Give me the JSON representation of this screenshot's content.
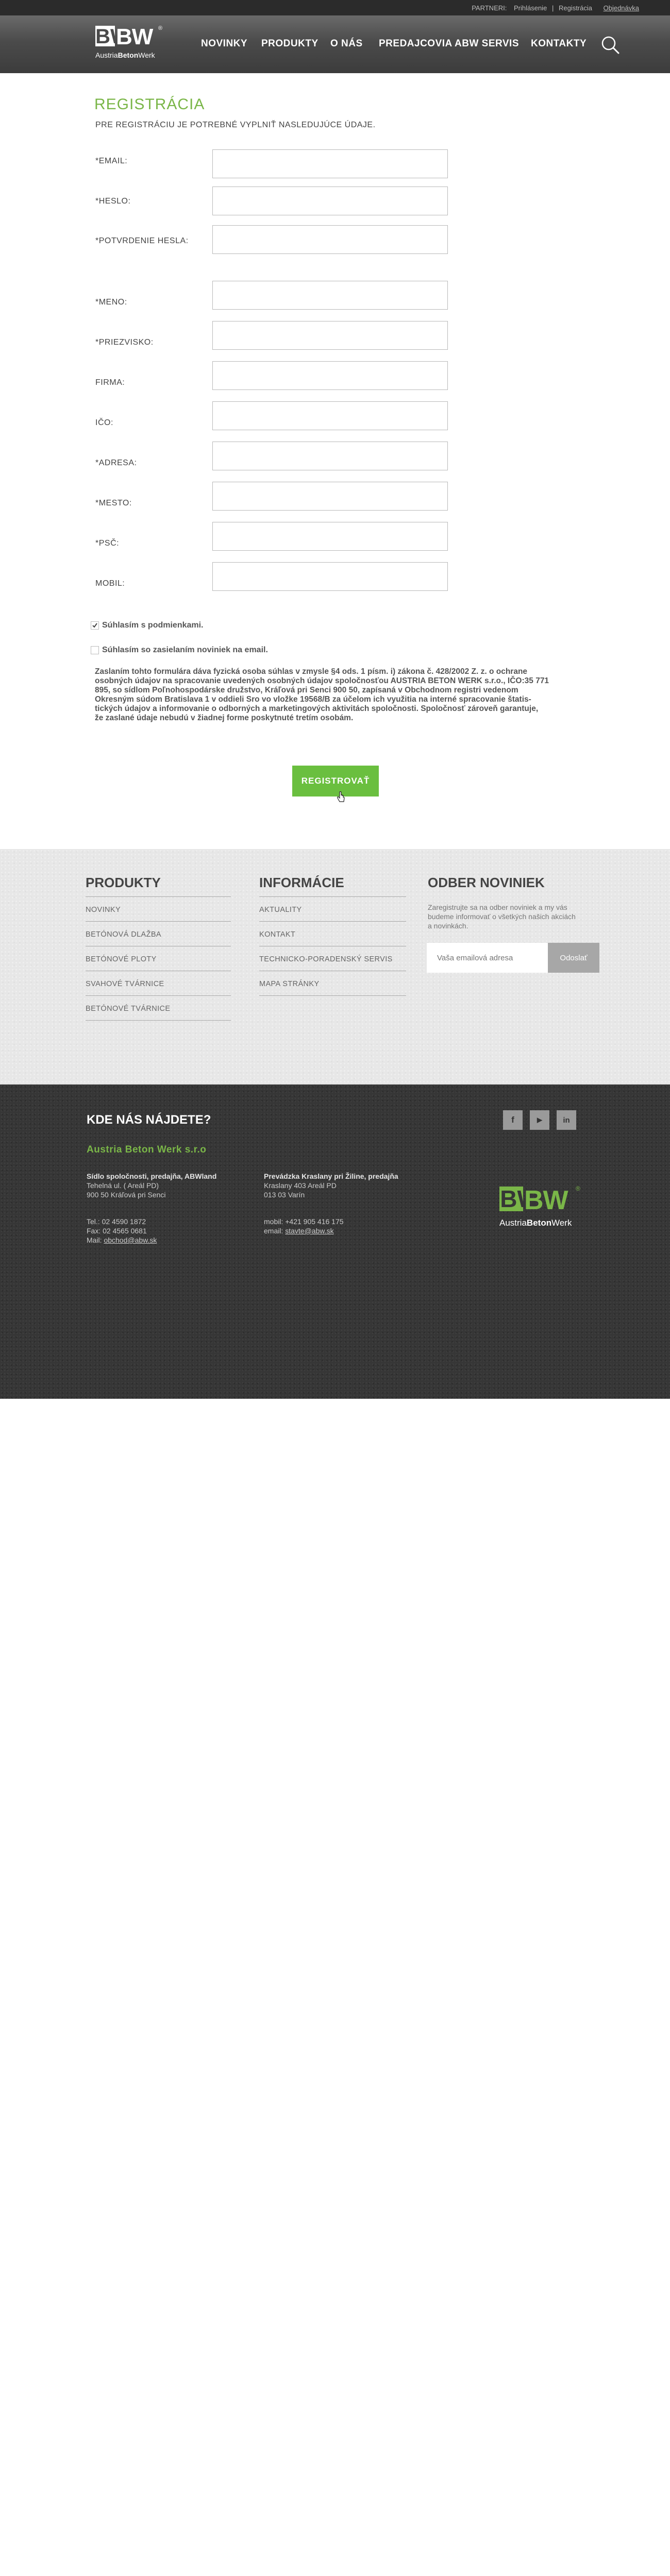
{
  "topbar": {
    "partneri": "PARTNERI:",
    "login": "Prihlásenie",
    "sep": "|",
    "register": "Registrácia",
    "cart": "Objednávka"
  },
  "logo": {
    "top": "ABW",
    "bottom_light": "Austria",
    "bottom_bold": "Beton",
    "bottom_end": "Werk",
    "reg": "®"
  },
  "nav": [
    "NOVINKY",
    "PRODUKTY",
    "O NÁS",
    "PREDAJCOVIA",
    "ABW SERVIS",
    "KONTAKTY"
  ],
  "form": {
    "title": "REGISTRÁCIA",
    "subtitle": "PRE REGISTRÁCIU JE POTREBNÉ VYPLNIŤ NASLEDUJÚCE ÚDAJE.",
    "fields": [
      {
        "label": "*EMAIL:",
        "value": ""
      },
      {
        "label": "*HESLO:",
        "value": ""
      },
      {
        "label": "*POTVRDENIE HESLA:",
        "value": ""
      },
      {
        "label": "*MENO:",
        "value": ""
      },
      {
        "label": "*PRIEZVISKO:",
        "value": ""
      },
      {
        "label": "FIRMA:",
        "value": ""
      },
      {
        "label": "IČO:",
        "value": ""
      },
      {
        "label": "*ADRESA:",
        "value": ""
      },
      {
        "label": "*MESTO:",
        "value": ""
      },
      {
        "label": "*PSČ:",
        "value": ""
      },
      {
        "label": "MOBIL:",
        "value": ""
      }
    ],
    "agree_terms": {
      "label": "Súhlasím s podmienkami.",
      "checked": true
    },
    "agree_news": {
      "label": "Súhlasím so zasielaním noviniek na email.",
      "checked": false
    },
    "consent_lines": [
      "Zaslaním tohto formulára dáva fyzická osoba súhlas v zmysle §4 ods. 1 písm. i) zákona č. 428/2002 Z. z. o ochrane",
      "osobných údajov na spracovanie uvedených osobných údajov spoločnosťou AUSTRIA BETON WERK s.r.o., IČO:35 771",
      "895, so sídlom Poľnohospodárske družstvo, Kráľová pri Senci 900 50, zapísaná v Obchodnom registri vedenom",
      "Okresným súdom Bratislava 1 v oddieli Sro vo vložke 19568/B za účelom ich využitia na interné spracovanie štatis-",
      "tických údajov a informovanie o odborných a marketingových aktivitách spoločnosti. Spoločnosť zároveň garantuje,",
      "že zaslané údaje nebudú v žiadnej forme poskytnuté tretím osobám."
    ],
    "submit": "REGISTROVAŤ"
  },
  "footer_links": {
    "produkty": {
      "heading": "PRODUKTY",
      "items": [
        "NOVINKY",
        "BETÓNOVÁ DLAŽBA",
        "BETÓNOVÉ PLOTY",
        "SVAHOVÉ TVÁRNICE",
        "BETÓNOVÉ TVÁRNICE"
      ]
    },
    "informacie": {
      "heading": "INFORMÁCIE",
      "items": [
        "AKTUALITY",
        "KONTAKT",
        "TECHNICKO-PORADENSKÝ SERVIS",
        "MAPA STRÁNKY"
      ]
    },
    "newsletter": {
      "heading": "ODBER NOVINIEK",
      "text_lines": [
        "Zaregistrujte sa na odber noviniek a my vás",
        "budeme informovať o všetkých našich akciách",
        "a novinkách."
      ],
      "placeholder": "Vaša emailová adresa",
      "button": "Odoslať"
    }
  },
  "contact": {
    "heading": "KDE NÁS NÁJDETE?",
    "company": "Austria Beton Werk s.r.o",
    "left": {
      "title": "Sídlo spoločnosti, predajňa, ABWland",
      "address1": "Tehelná ul. ( Areál PD)",
      "address2": "900 50 Kráľová pri Senci",
      "tel": "Tel.: 02 4590 1872",
      "fax": "Fax: 02 4565 0681",
      "mail_label": "Mail: ",
      "mail": "obchod@abw.sk"
    },
    "right": {
      "title": "Prevádzka Kraslany pri Žiline, predajňa",
      "address1": "Kraslany 403 Areál PD",
      "address2": "013 03 Varín",
      "mobil": "mobil: +421 905 416 175",
      "email_label": "email: ",
      "email": "stavte@abw.sk"
    },
    "social": [
      "f",
      "▶",
      "in"
    ]
  },
  "colors": {
    "accent": "#7ab648",
    "button": "#6abf3f",
    "dark": "#363636"
  }
}
